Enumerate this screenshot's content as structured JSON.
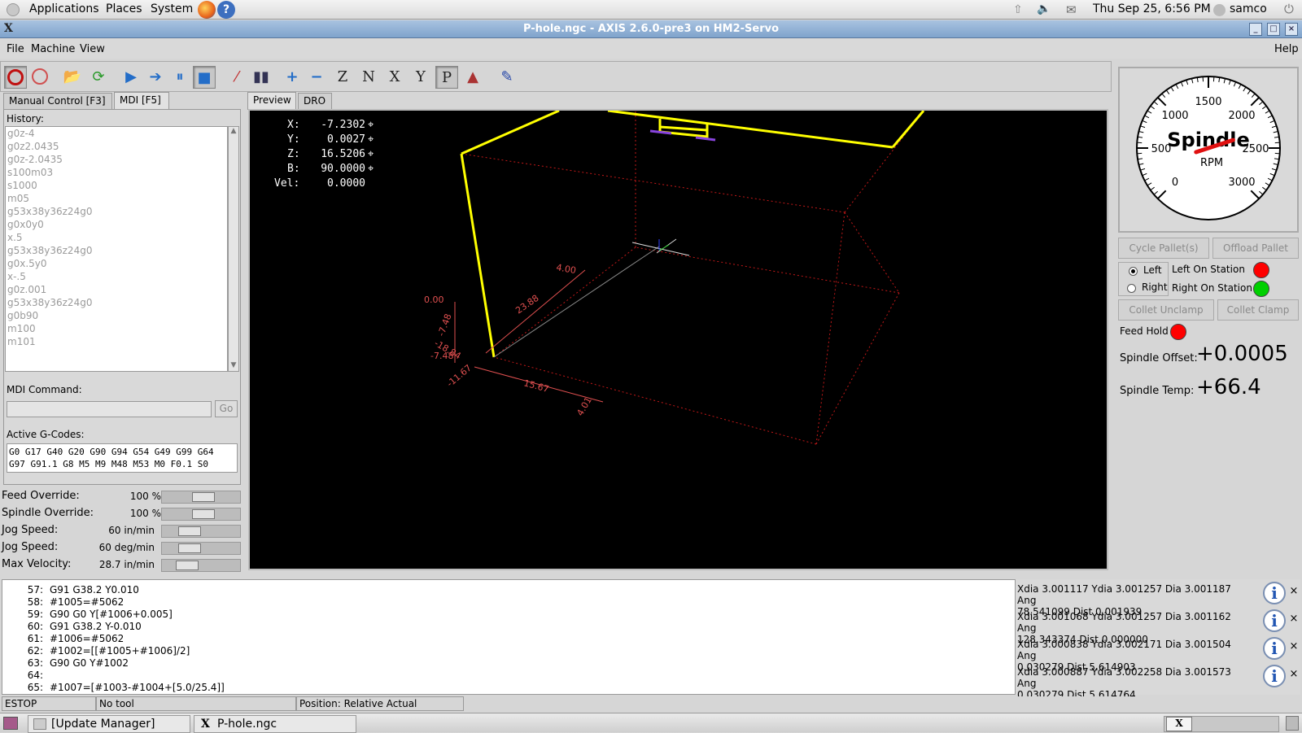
{
  "topbar": {
    "menus": [
      "Applications",
      "Places",
      "System"
    ],
    "clock": "Thu Sep 25,  6:56 PM",
    "user": "samco",
    "icons": [
      "update-icon",
      "volume-icon",
      "mail-icon",
      "power-icon"
    ]
  },
  "window": {
    "title": "P-hole.ngc - AXIS 2.6.0-pre3 on HM2-Servo",
    "controls": [
      "minimize",
      "maximize",
      "close"
    ]
  },
  "menubar": {
    "items": [
      "File",
      "Machine",
      "View"
    ],
    "help": "Help"
  },
  "toolbar": {
    "icons": [
      "estop-icon",
      "power-icon",
      "open-icon",
      "reload-icon",
      "run-icon",
      "step-icon",
      "pause-icon",
      "stop-icon",
      "block-delete-icon",
      "optional-stop-icon",
      "zoom-in-icon",
      "zoom-out-icon",
      "view-z-icon",
      "view-z2-icon",
      "view-x-icon",
      "view-y-icon",
      "view-p-icon",
      "rotate-view-icon",
      "clear-plot-icon"
    ]
  },
  "tabs": {
    "left": [
      "Manual Control [F3]",
      "MDI [F5]"
    ],
    "right": [
      "Preview",
      "DRO"
    ]
  },
  "mdi": {
    "history_label": "History:",
    "history": [
      "g0z-4",
      "g0z2.0435",
      "g0z-2.0435",
      "s100m03",
      "s1000",
      "m05",
      "g53x38y36z24g0",
      "g0x0y0",
      "x.5",
      "g53x38y36z24g0",
      "g0x.5y0",
      "x-.5",
      "g0z.001",
      "g53x38y36z24g0",
      "g0b90",
      "m100",
      "m101"
    ],
    "command_label": "MDI Command:",
    "go": "Go",
    "gcodes_label": "Active G-Codes:",
    "gcodes_line1": "G0 G17 G40 G20 G90 G94 G54 G49 G99 G64",
    "gcodes_line2": "G97 G91.1 G8 M5 M9 M48 M53 M0 F0.1 S0"
  },
  "overrides": [
    {
      "label": "Feed Override:",
      "value": "100 %",
      "level": 0.55
    },
    {
      "label": "Spindle Override:",
      "value": "100 %",
      "level": 0.55
    },
    {
      "label": "Jog Speed:",
      "value": "60 in/min",
      "level": 0.3
    },
    {
      "label": "Jog Speed:",
      "value": "60 deg/min",
      "level": 0.3
    },
    {
      "label": "Max Velocity:",
      "value": "28.7 in/min",
      "level": 0.25
    }
  ],
  "dro": {
    "x_label": "X:",
    "x": "-7.2302",
    "y_label": "Y:",
    "y": "0.0027",
    "z_label": "Z:",
    "z": "16.5206",
    "b_label": "B:",
    "b": "90.0000",
    "vel_label": "Vel:",
    "vel": "0.0000"
  },
  "preview": {
    "dims": [
      "0.00",
      "-7.48",
      "-7.48",
      "-18.84",
      "23.88",
      "4.00",
      "-11.67",
      "15.67",
      "4.01"
    ]
  },
  "spindle": {
    "title": "Spindle",
    "unit": "RPM",
    "ticks": [
      "0",
      "500",
      "1000",
      "1500",
      "2000",
      "2500",
      "3000"
    ],
    "value": 300,
    "max": 3000
  },
  "pallet": {
    "cycle": "Cycle Pallet(s)",
    "offload": "Offload Pallet",
    "left": "Left",
    "right": "Right",
    "left_station": "Left On Station",
    "right_station": "Right On Station",
    "collet_unclamp": "Collet Unclamp",
    "collet_clamp": "Collet Clamp",
    "feed_hold": "Feed Hold",
    "spindle_offset_label": "Spindle Offset:",
    "spindle_offset": "+0.0005",
    "spindle_temp_label": "Spindle Temp:",
    "spindle_temp": "+66.4",
    "colors": {
      "red": "#ff0000",
      "green": "#00d000"
    }
  },
  "code": [
    {
      "n": "57:",
      "t": "G91 G38.2 Y0.010"
    },
    {
      "n": "58:",
      "t": "#1005=#5062"
    },
    {
      "n": "59:",
      "t": "G90 G0 Y[#1006+0.005]"
    },
    {
      "n": "60:",
      "t": "G91 G38.2 Y-0.010"
    },
    {
      "n": "61:",
      "t": "#1006=#5062"
    },
    {
      "n": "62:",
      "t": "#1002=[[#1005+#1006]/2]"
    },
    {
      "n": "63:",
      "t": "G90 G0 Y#1002"
    },
    {
      "n": "64:",
      "t": ""
    },
    {
      "n": "65:",
      "t": "#1007=[#1003-#1004+[5.0/25.4]]"
    }
  ],
  "messages": [
    {
      "l1": "Xdia 3.001117 Ydia 3.001257 Dia 3.001187 Ang",
      "l2": "78.541099 Dist 0.001939"
    },
    {
      "l1": "Xdia 3.001068 Ydia 3.001257 Dia 3.001162 Ang",
      "l2": "128.343374 Dist 0.000000"
    },
    {
      "l1": "Xdia 3.000838 Ydia 3.002171 Dia 3.001504 Ang",
      "l2": "0.030279 Dist 5.614903"
    },
    {
      "l1": "Xdia 3.000887 Ydia 3.002258 Dia 3.001573 Ang",
      "l2": "0.030279 Dist 5.614764"
    }
  ],
  "status": {
    "state": "ESTOP",
    "tool": "No tool",
    "position": "Position: Relative Actual"
  },
  "taskbar": {
    "items": [
      "[Update Manager]",
      "P-hole.ngc"
    ]
  }
}
